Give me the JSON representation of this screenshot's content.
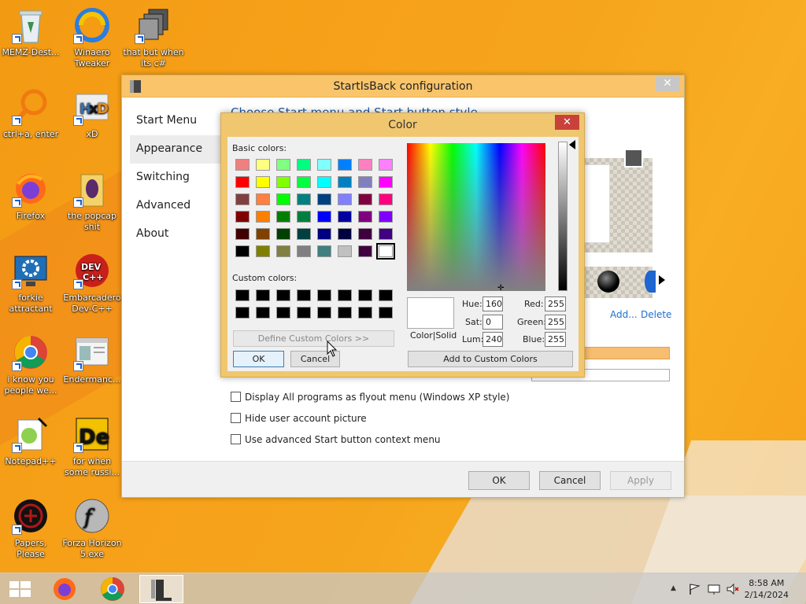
{
  "desktop": {
    "icons": [
      {
        "label": "MEMZ-Dest...",
        "icon": "recycle-bin-icon"
      },
      {
        "label": "Winaero Tweaker",
        "icon": "winaero-icon"
      },
      {
        "label": "that but when its c#",
        "icon": "stack-icon"
      },
      {
        "label": "ctrl+a, enter",
        "icon": "magnifier-icon"
      },
      {
        "label": "xD",
        "icon": "hxd-icon"
      },
      {
        "label": "Firefox",
        "icon": "firefox-icon"
      },
      {
        "label": "the popcap shit",
        "icon": "folder-icon"
      },
      {
        "label": "forkie attractant",
        "icon": "settings-monitor-icon"
      },
      {
        "label": "Embarcadero Dev-C++",
        "icon": "devcpp-icon"
      },
      {
        "label": "i know you people we...",
        "icon": "chrome-icon"
      },
      {
        "label": "Endermanc...",
        "icon": "window-icon"
      },
      {
        "label": "Notepad++",
        "icon": "notepadpp-icon"
      },
      {
        "label": "for when some russi...",
        "icon": "de-icon"
      },
      {
        "label": "Papers, Please",
        "icon": "papers-please-icon"
      },
      {
        "label": "Forza Horizon 5.exe",
        "icon": "flash-icon"
      }
    ]
  },
  "window": {
    "title": "StartIsBack configuration",
    "close": "✕",
    "nav": [
      "Start Menu",
      "Appearance",
      "Switching",
      "Advanced",
      "About"
    ],
    "heading": "Choose Start menu and Start button style",
    "links": {
      "add": "Add...",
      "delete": "Delete"
    },
    "checkboxes": [
      "Display All programs as flyout menu (Windows XP style)",
      "Hide user account picture",
      "Use advanced Start button context menu"
    ],
    "buttons": {
      "ok": "OK",
      "cancel": "Cancel",
      "apply": "Apply"
    }
  },
  "color_dialog": {
    "title": "Color",
    "close": "✕",
    "basic_label": "Basic colors:",
    "custom_label": "Custom colors:",
    "basic_colors": [
      "#f08080",
      "#ffff80",
      "#80ff80",
      "#00ff80",
      "#80ffff",
      "#0080ff",
      "#ff80c0",
      "#ff80ff",
      "#ff0000",
      "#ffff00",
      "#80ff00",
      "#00ff40",
      "#00ffff",
      "#0080c0",
      "#8080c0",
      "#ff00ff",
      "#804040",
      "#ff8040",
      "#00ff00",
      "#008080",
      "#004080",
      "#8080ff",
      "#800040",
      "#ff0080",
      "#800000",
      "#ff8000",
      "#008000",
      "#008040",
      "#0000ff",
      "#0000a0",
      "#800080",
      "#8000ff",
      "#400000",
      "#804000",
      "#004000",
      "#004040",
      "#000080",
      "#000040",
      "#400040",
      "#400080",
      "#000000",
      "#808000",
      "#808040",
      "#808080",
      "#408080",
      "#c0c0c0",
      "#400040",
      "#ffffff"
    ],
    "custom_colors": [
      "#000000",
      "#000000",
      "#000000",
      "#000000",
      "#000000",
      "#000000",
      "#000000",
      "#000000",
      "#000000",
      "#000000",
      "#000000",
      "#000000",
      "#000000",
      "#000000",
      "#000000",
      "#000000"
    ],
    "define_custom": "Define Custom Colors >>",
    "ok": "OK",
    "cancel": "Cancel",
    "color_solid": "Color|Solid",
    "fields": {
      "hue_label": "Hue:",
      "hue": "160",
      "sat_label": "Sat:",
      "sat": "0",
      "lum_label": "Lum:",
      "lum": "240",
      "red_label": "Red:",
      "red": "255",
      "green_label": "Green:",
      "green": "255",
      "blue_label": "Blue:",
      "blue": "255"
    },
    "add_custom": "Add to Custom Colors"
  },
  "taskbar": {
    "clock_time": "8:58 AM",
    "clock_date": "2/14/2024",
    "tray_up": "▲"
  }
}
